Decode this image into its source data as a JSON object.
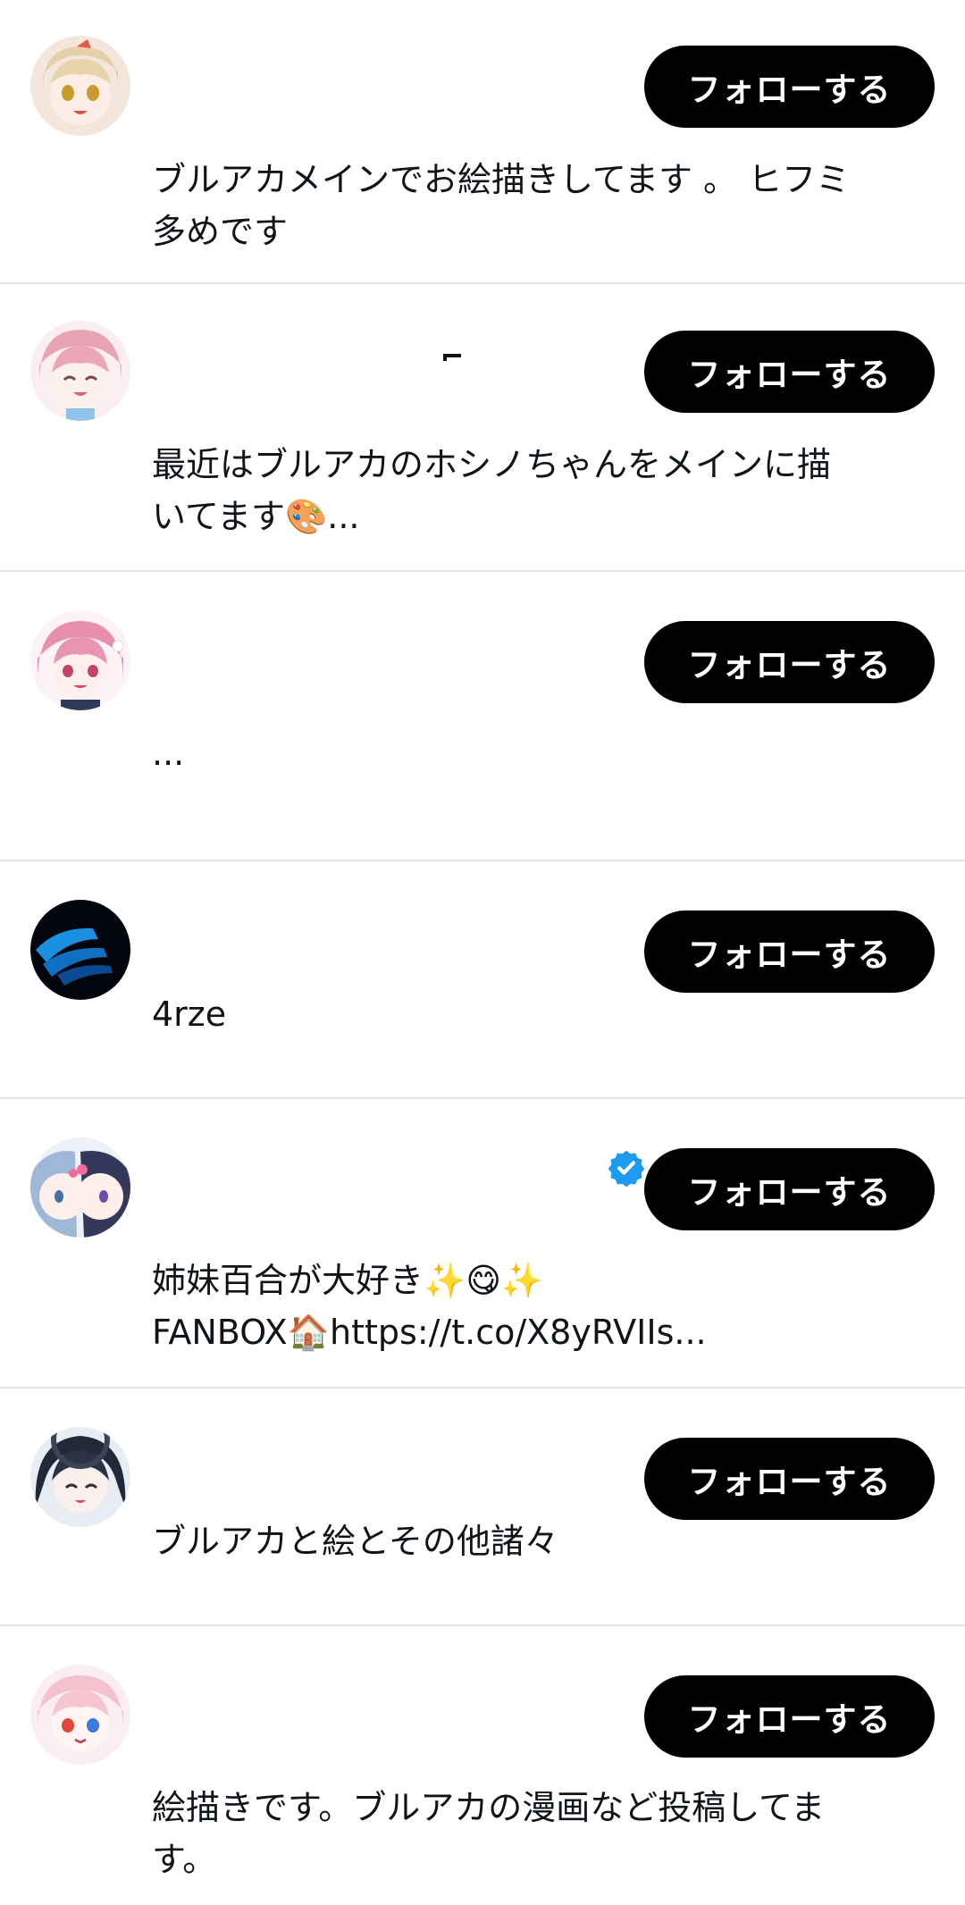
{
  "follow_label": "フォローする",
  "users": [
    {
      "bio": "ブルアカメインでお絵描きしてます 。 ヒフミ\n多めです",
      "avatar": "anime-girl-blonde-avatar"
    },
    {
      "bio": "最近はブルアカのホシノちゃんをメインに描\nいてます🎨...",
      "avatar": "anime-girl-pink-avatar"
    },
    {
      "bio": "...",
      "avatar": "anime-girl-pink-maid-avatar"
    },
    {
      "bio": "4rze",
      "avatar": "blue-streak-avatar"
    },
    {
      "bio": "姉妹百合が大好き✨😋✨\nFANBOX🏠https://t.co/X8yRVIIs...",
      "avatar": "two-anime-girls-avatar",
      "verified": true
    },
    {
      "bio": "ブルアカと絵とその他諸々",
      "avatar": "anime-girl-dark-hair-avatar"
    },
    {
      "bio": "絵描きです。ブルアカの漫画など投稿してま\nす。",
      "avatar": "anime-girl-heterochromia-avatar"
    }
  ],
  "colors": {
    "button_bg": "#000000",
    "button_text": "#ffffff",
    "divider": "#e6e6e6",
    "verified": "#1d9bf0"
  }
}
